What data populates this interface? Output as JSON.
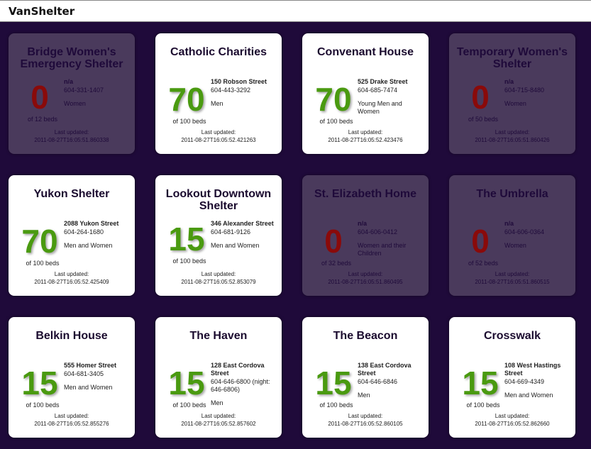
{
  "app": {
    "title": "VanShelter"
  },
  "shelters": [
    {
      "name": "Bridge Women's Emergency Shelter",
      "beds_available": "0",
      "beds_total": "of 12 beds",
      "street": "n/a",
      "phone": "604-331-1407",
      "gender": "Women",
      "updated_label": "Last updated:",
      "updated": "2011-08-27T16:05:51.860338",
      "full": true
    },
    {
      "name": "Catholic Charities",
      "beds_available": "70",
      "beds_total": "of 100 beds",
      "street": "150 Robson Street",
      "phone": "604-443-3292",
      "gender": "Men",
      "updated_label": "Last updated:",
      "updated": "2011-08-27T16:05:52.421263",
      "full": false
    },
    {
      "name": "Convenant House",
      "beds_available": "70",
      "beds_total": "of 100 beds",
      "street": "525 Drake Street",
      "phone": "604-685-7474",
      "gender": "Young Men and Women",
      "updated_label": "Last updated:",
      "updated": "2011-08-27T16:05:52.423476",
      "full": false
    },
    {
      "name": "Temporary Women's Shelter",
      "beds_available": "0",
      "beds_total": "of 50 beds",
      "street": "n/a",
      "phone": "604-715-8480",
      "gender": "Women",
      "updated_label": "Last updated:",
      "updated": "2011-08-27T16:05:51.860426",
      "full": true
    },
    {
      "name": "Yukon Shelter",
      "beds_available": "70",
      "beds_total": "of 100 beds",
      "street": "2088 Yukon Street",
      "phone": "604-264-1680",
      "gender": "Men and Women",
      "updated_label": "Last updated:",
      "updated": "2011-08-27T16:05:52.425409",
      "full": false
    },
    {
      "name": "Lookout Downtown Shelter",
      "beds_available": "15",
      "beds_total": "of 100 beds",
      "street": "346 Alexander Street",
      "phone": "604-681-9126",
      "gender": "Men and Women",
      "updated_label": "Last updated:",
      "updated": "2011-08-27T16:05:52.853079",
      "full": false
    },
    {
      "name": "St. Elizabeth Home",
      "beds_available": "0",
      "beds_total": "of 32 beds",
      "street": "n/a",
      "phone": "604-606-0412",
      "gender": "Women and their Children",
      "updated_label": "Last updated:",
      "updated": "2011-08-27T16:05:51.860495",
      "full": true
    },
    {
      "name": "The Umbrella",
      "beds_available": "0",
      "beds_total": "of 52 beds",
      "street": "n/a",
      "phone": "604-606-0364",
      "gender": "Women",
      "updated_label": "Last updated:",
      "updated": "2011-08-27T16:05:51.860515",
      "full": true
    },
    {
      "name": "Belkin House",
      "beds_available": "15",
      "beds_total": "of 100 beds",
      "street": "555 Homer Street",
      "phone": "604-681-3405",
      "gender": "Men and Women",
      "updated_label": "Last updated:",
      "updated": "2011-08-27T16:05:52.855276",
      "full": false
    },
    {
      "name": "The Haven",
      "beds_available": "15",
      "beds_total": "of 100 beds",
      "street": "128 East Cordova Street",
      "phone": "604-646-6800 (night: 646-6806)",
      "gender": "Men",
      "updated_label": "Last updated:",
      "updated": "2011-08-27T16:05:52.857602",
      "full": false
    },
    {
      "name": "The Beacon",
      "beds_available": "15",
      "beds_total": "of 100 beds",
      "street": "138 East Cordova Street",
      "phone": "604-646-6846",
      "gender": "Men",
      "updated_label": "Last updated:",
      "updated": "2011-08-27T16:05:52.860105",
      "full": false
    },
    {
      "name": "Crosswalk",
      "beds_available": "15",
      "beds_total": "of 100 beds",
      "street": "108 West Hastings Street",
      "phone": "604-669-4349",
      "gender": "Men and Women",
      "updated_label": "Last updated:",
      "updated": "2011-08-27T16:05:52.862660",
      "full": false
    }
  ],
  "colors": {
    "background": "#1f0a3a",
    "available": "#4a9a10",
    "full": "#8a0a0a",
    "full_card": "#4a3a5c"
  }
}
